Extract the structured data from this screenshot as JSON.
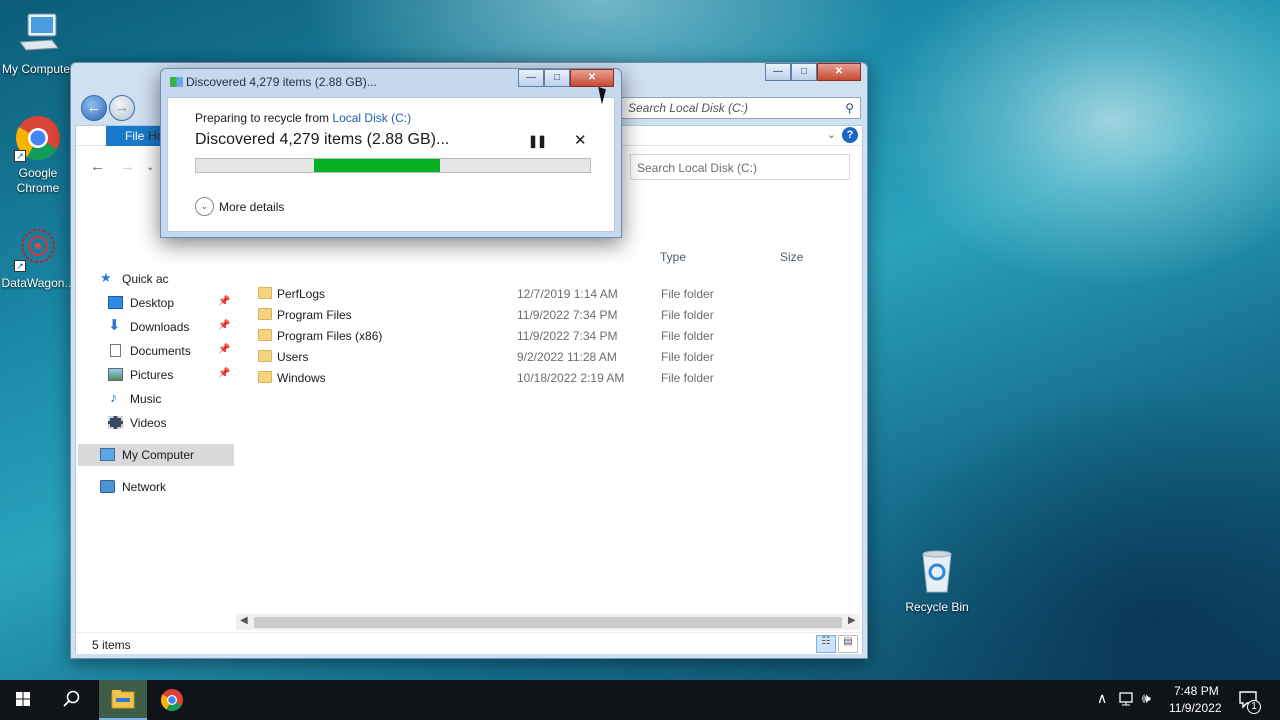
{
  "desktop": {
    "icons": [
      {
        "label": "My Computer"
      },
      {
        "label": "Google Chrome"
      },
      {
        "label": "DataWagon..."
      },
      {
        "label": "Recycle Bin"
      }
    ]
  },
  "explorer": {
    "search_placeholder_top": "Search Local Disk (C:)",
    "ribbon": {
      "file_tab": "File",
      "home_tab": "Ho"
    },
    "search_placeholder": "Search Local Disk (C:)",
    "columns": {
      "type": "Type",
      "size": "Size"
    },
    "nav": [
      {
        "label": "Quick ac"
      },
      {
        "label": "Desktop"
      },
      {
        "label": "Downloads"
      },
      {
        "label": "Documents"
      },
      {
        "label": "Pictures"
      },
      {
        "label": "Music"
      },
      {
        "label": "Videos"
      },
      {
        "label": "My Computer"
      },
      {
        "label": "Network"
      }
    ],
    "files": [
      {
        "name": "PerfLogs",
        "date": "12/7/2019 1:14 AM",
        "type": "File folder"
      },
      {
        "name": "Program Files",
        "date": "11/9/2022 7:34 PM",
        "type": "File folder"
      },
      {
        "name": "Program Files (x86)",
        "date": "11/9/2022 7:34 PM",
        "type": "File folder"
      },
      {
        "name": "Users",
        "date": "9/2/2022 11:28 AM",
        "type": "File folder"
      },
      {
        "name": "Windows",
        "date": "10/18/2022 2:19 AM",
        "type": "File folder"
      }
    ],
    "status": "5 items"
  },
  "dialog": {
    "title": "Discovered 4,279 items (2.88 GB)...",
    "preparing_prefix": "Preparing to recycle from ",
    "preparing_location": "Local Disk (C:)",
    "headline": "Discovered 4,279 items (2.88 GB)...",
    "progress_start": 0.3,
    "progress_end": 0.62,
    "more_details": "More details",
    "accent": "#06b025"
  },
  "taskbar": {
    "time": "7:48 PM",
    "date": "11/9/2022",
    "notification_count": "1"
  }
}
